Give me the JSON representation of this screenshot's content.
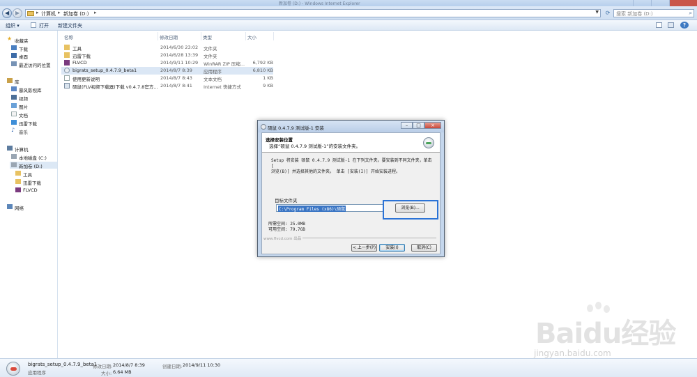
{
  "window": {
    "title": "新加卷 (D:) - Windows Internet Explorer"
  },
  "address_bar": {
    "crumbs": [
      "计算机",
      "新加卷 (D:)"
    ],
    "search_placeholder": "搜索 新加卷 (D:)"
  },
  "toolbar": {
    "organize": "组织 ▾",
    "open": "打开",
    "new_folder": "新建文件夹"
  },
  "nav_pane": {
    "favorites": "收藏夹",
    "downloads": "下载",
    "desktop": "桌面",
    "recent": "最近访问的位置",
    "library": "库",
    "storm_video": "暴风影视库",
    "video": "视频",
    "pictures": "图片",
    "documents": "文档",
    "thunder": "迅雷下载",
    "music": "音乐",
    "computer": "计算机",
    "local_c": "本地磁盘 (C:)",
    "new_d": "新加卷 (D:)",
    "d_tools": "工具",
    "d_thunder": "迅雷下载",
    "d_flvcd": "FLVCD",
    "network": "网络"
  },
  "columns": {
    "name": "名称",
    "modified": "修改日期",
    "type": "类型",
    "size": "大小"
  },
  "files": [
    {
      "name": "工具",
      "date": "2014/6/30 23:02",
      "type": "文件夹",
      "size": "",
      "icon": "folder-icon"
    },
    {
      "name": "迅雷下载",
      "date": "2014/6/28 13:39",
      "type": "文件夹",
      "size": "",
      "icon": "folder-icon"
    },
    {
      "name": "FLVCD",
      "date": "2014/9/11 10:29",
      "type": "WinRAR ZIP 压缩...",
      "size": "6,792 KB",
      "icon": "archive-icon"
    },
    {
      "name": "bigrats_setup_0.4.7.9_beta1",
      "date": "2014/8/7 8:39",
      "type": "应用程序",
      "size": "6,810 KB",
      "icon": "app-icon"
    },
    {
      "name": "使用更新说明",
      "date": "2014/8/7 8:43",
      "type": "文本文档",
      "size": "1 KB",
      "icon": "text-file-icon"
    },
    {
      "name": "硕鼠(FLV视频下载器)下载 v0.4.7.8官方...",
      "date": "2014/8/7 8:41",
      "type": "Internet 快捷方式",
      "size": "9 KB",
      "icon": "shortcut-icon"
    }
  ],
  "dialog": {
    "title": "硕鼠 0.4.7.9 测试版-1 安装",
    "header_title": "选择安装位置",
    "header_sub": "选择“硕鼠 0.4.7.9 测试版-1”的安装文件夹。",
    "intro_line1": "Setup 将安装 硕鼠 0.4.7.9 测试版-1 在下列文件夹。要安装到不同文件夹，单击 [",
    "intro_line2": "浏览(B)] 并选择其他的文件夹。 单击 [安装(I)] 开始安装进程。",
    "target_label": "目标文件夹",
    "target_path": "C:\\Program Files (x86)\\硕鼠",
    "browse": "浏览(B)...",
    "space_required": "所需空间: 25.0MB",
    "space_available": "可用空间: 79.7GB",
    "brand": "www.flvcd.com 出品",
    "back": "< 上一步(P)",
    "install": "安装(I)",
    "cancel": "取消(C)"
  },
  "status": {
    "filename": "bigrats_setup_0.4.7.9_beta1",
    "modified_label": "修改日期:",
    "modified": "2014/8/7 8:39",
    "created_label": "创建日期:",
    "created": "2014/9/11 10:30",
    "type": "应用程序",
    "size_label": "大小:",
    "size": "6.64 MB"
  },
  "watermark": {
    "logo": "Baidu经验",
    "url": "jingyan.baidu.com"
  },
  "colors": {
    "selection": "#dbe7f5",
    "highlight_box": "#2b73d6",
    "title_bar": "#c9dcf2"
  }
}
